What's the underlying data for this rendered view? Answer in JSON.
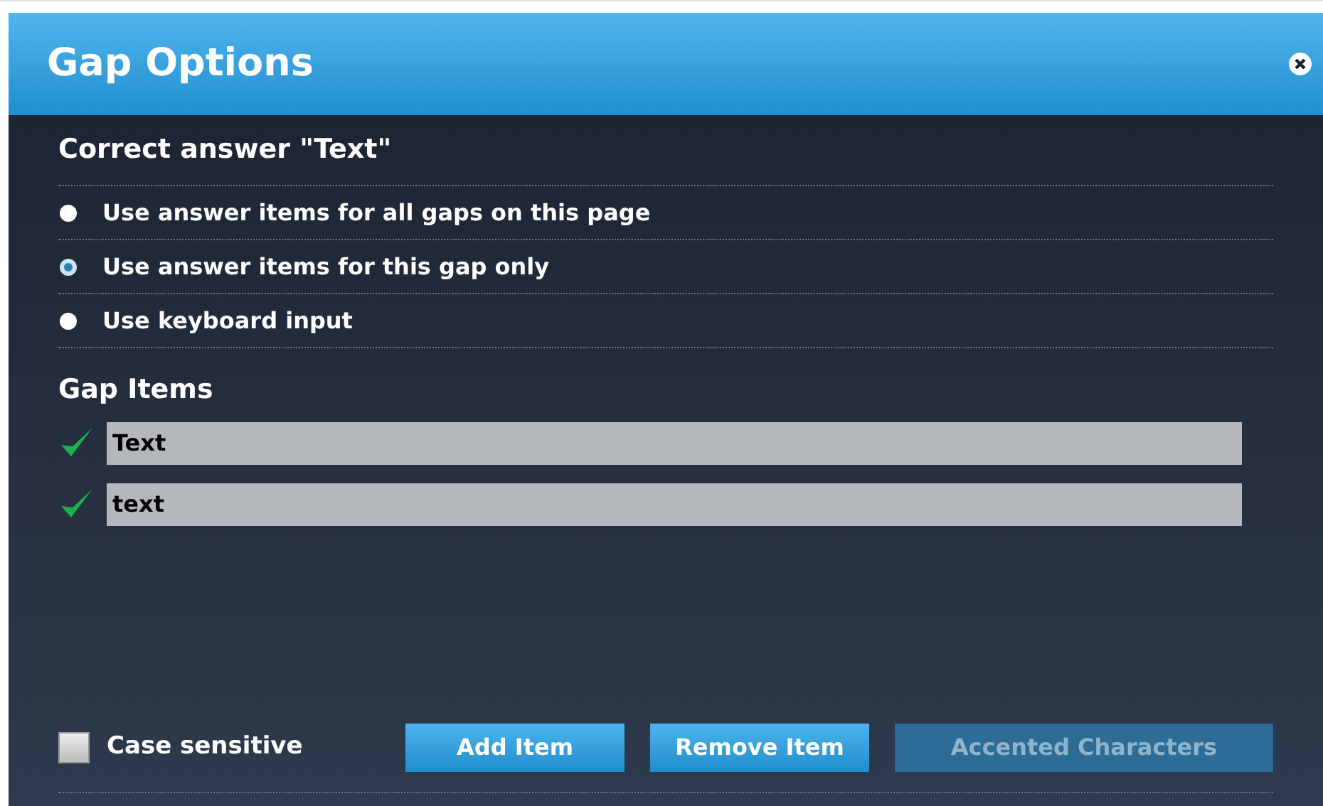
{
  "dialog": {
    "title": "Gap Options"
  },
  "section_title": "Correct answer \"Text\"",
  "options": [
    {
      "label": "Use answer items for all gaps on this page",
      "selected": false
    },
    {
      "label": "Use answer items for this gap only",
      "selected": true
    },
    {
      "label": "Use keyboard input",
      "selected": false
    }
  ],
  "items_title": "Gap Items",
  "items": [
    {
      "value": "Text",
      "checked": true
    },
    {
      "value": "text",
      "checked": true
    }
  ],
  "case_sensitive": {
    "label": "Case sensitive",
    "checked": false
  },
  "buttons": [
    {
      "label": "Add Item",
      "disabled": false
    },
    {
      "label": "Remove Item",
      "disabled": false
    },
    {
      "label": "Accented Characters",
      "disabled": true
    }
  ]
}
